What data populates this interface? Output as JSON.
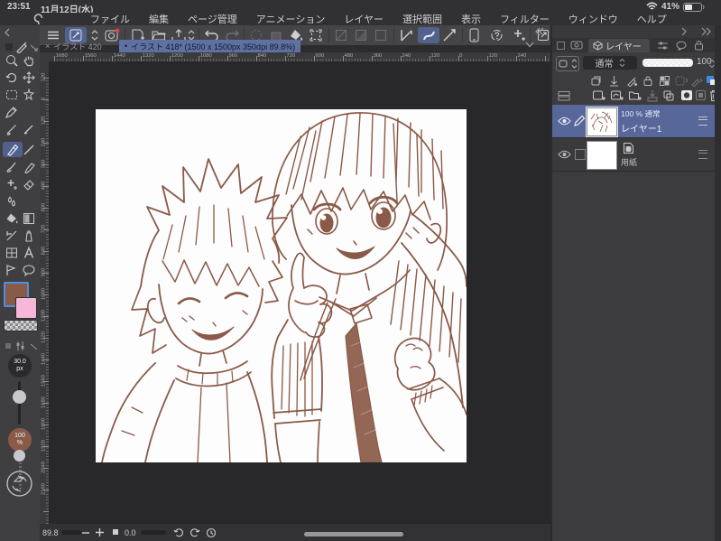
{
  "status_bar": {
    "time": "23:51",
    "date": "11月12日(水)",
    "battery_percent": "41%"
  },
  "menu_bar": {
    "items": [
      "ファイル",
      "編集",
      "ページ管理",
      "アニメーション",
      "レイヤー",
      "選択範囲",
      "表示",
      "フィルター",
      "ウィンドウ",
      "ヘルプ"
    ]
  },
  "tab_bar": {
    "tabs": [
      {
        "close_icon": "×",
        "label": "イラスト 420"
      },
      {
        "bullet_icon": "•",
        "label": "イラスト 418* (1500 x 1500px 350dpi 89.8%)"
      }
    ]
  },
  "rulers": {
    "horizontal": [
      "1680",
      "1560",
      "1440",
      "1320",
      "1200",
      "1080",
      "960",
      "840",
      "720",
      "600",
      "480",
      "360",
      "240",
      "120",
      "0",
      "120",
      "240"
    ],
    "vertical": [
      "120",
      "0",
      "120",
      "240",
      "360",
      "480",
      "600",
      "720",
      "840",
      "960",
      "1080",
      "1200",
      "1320",
      "1440",
      "1560",
      "1680",
      "1800",
      "1920",
      "2040",
      "2160"
    ]
  },
  "tool_palette": {
    "tools": [
      "zoom",
      "pan",
      "rotate-view",
      "move-layer",
      "marquee-select",
      "auto-select",
      "eyedropper",
      "pen",
      "pencil",
      "brush",
      "marker",
      "add-sub-tool",
      "eraser",
      "blend",
      "fill-bucket",
      "gradient",
      "figure-line",
      "airbrush",
      "frame-border",
      "text",
      "line-correction",
      "balloon"
    ],
    "selected_tool": "pen"
  },
  "color_swatches": {
    "main": "#8a5a49",
    "sub": "#f7b7d9",
    "main_selected": true
  },
  "tool_property": {
    "size_value": "30.0",
    "size_unit": "px",
    "opacity_value": "100",
    "opacity_unit": "%"
  },
  "layers_panel": {
    "tab_label": "レイヤー",
    "blend_mode": "通常",
    "opacity_value": "100",
    "layers": [
      {
        "info": "100 % 通常",
        "name": "レイヤー1",
        "selected": true,
        "visible": true,
        "editing": true
      },
      {
        "name": "用紙",
        "selected": false,
        "visible": true
      }
    ]
  },
  "bottom_bar": {
    "zoom_percent": "89.8",
    "rotation": "0.0"
  },
  "artwork": {
    "ink_color": "#8a5948",
    "description": "rough sketch of two smiling boys, one pointing up"
  }
}
